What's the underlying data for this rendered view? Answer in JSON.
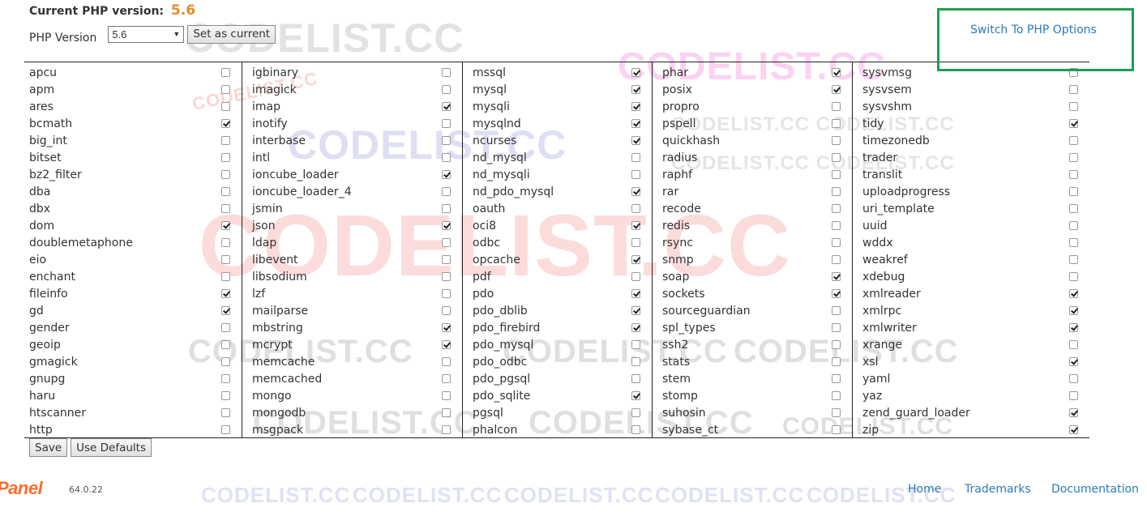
{
  "header": {
    "current_label": "Current PHP version:",
    "current_value": "5.6",
    "version_label": "PHP Version",
    "version_selected": "5.6",
    "set_current_label": "Set as current",
    "switch_link": "Switch To PHP Options"
  },
  "columns": [
    [
      {
        "name": "apcu",
        "checked": false
      },
      {
        "name": "apm",
        "checked": false
      },
      {
        "name": "ares",
        "checked": false
      },
      {
        "name": "bcmath",
        "checked": true
      },
      {
        "name": "big_int",
        "checked": false
      },
      {
        "name": "bitset",
        "checked": false
      },
      {
        "name": "bz2_filter",
        "checked": false
      },
      {
        "name": "dba",
        "checked": false
      },
      {
        "name": "dbx",
        "checked": false
      },
      {
        "name": "dom",
        "checked": true
      },
      {
        "name": "doublemetaphone",
        "checked": false
      },
      {
        "name": "eio",
        "checked": false
      },
      {
        "name": "enchant",
        "checked": false
      },
      {
        "name": "fileinfo",
        "checked": true
      },
      {
        "name": "gd",
        "checked": true
      },
      {
        "name": "gender",
        "checked": false
      },
      {
        "name": "geoip",
        "checked": false
      },
      {
        "name": "gmagick",
        "checked": false
      },
      {
        "name": "gnupg",
        "checked": false
      },
      {
        "name": "haru",
        "checked": false
      },
      {
        "name": "htscanner",
        "checked": false
      },
      {
        "name": "http",
        "checked": false
      }
    ],
    [
      {
        "name": "igbinary",
        "checked": false
      },
      {
        "name": "imagick",
        "checked": false
      },
      {
        "name": "imap",
        "checked": true
      },
      {
        "name": "inotify",
        "checked": false
      },
      {
        "name": "interbase",
        "checked": false
      },
      {
        "name": "intl",
        "checked": false
      },
      {
        "name": "ioncube_loader",
        "checked": true
      },
      {
        "name": "ioncube_loader_4",
        "checked": false
      },
      {
        "name": "jsmin",
        "checked": false
      },
      {
        "name": "json",
        "checked": true
      },
      {
        "name": "ldap",
        "checked": false
      },
      {
        "name": "libevent",
        "checked": false
      },
      {
        "name": "libsodium",
        "checked": false
      },
      {
        "name": "lzf",
        "checked": false
      },
      {
        "name": "mailparse",
        "checked": false
      },
      {
        "name": "mbstring",
        "checked": true
      },
      {
        "name": "mcrypt",
        "checked": true
      },
      {
        "name": "memcache",
        "checked": false
      },
      {
        "name": "memcached",
        "checked": false
      },
      {
        "name": "mongo",
        "checked": false
      },
      {
        "name": "mongodb",
        "checked": false
      },
      {
        "name": "msgpack",
        "checked": false
      }
    ],
    [
      {
        "name": "mssql",
        "checked": true
      },
      {
        "name": "mysql",
        "checked": true
      },
      {
        "name": "mysqli",
        "checked": true
      },
      {
        "name": "mysqlnd",
        "checked": true
      },
      {
        "name": "ncurses",
        "checked": true
      },
      {
        "name": "nd_mysql",
        "checked": false
      },
      {
        "name": "nd_mysqli",
        "checked": false
      },
      {
        "name": "nd_pdo_mysql",
        "checked": true
      },
      {
        "name": "oauth",
        "checked": false
      },
      {
        "name": "oci8",
        "checked": true
      },
      {
        "name": "odbc",
        "checked": false
      },
      {
        "name": "opcache",
        "checked": true
      },
      {
        "name": "pdf",
        "checked": false
      },
      {
        "name": "pdo",
        "checked": true
      },
      {
        "name": "pdo_dblib",
        "checked": true
      },
      {
        "name": "pdo_firebird",
        "checked": true
      },
      {
        "name": "pdo_mysql",
        "checked": false
      },
      {
        "name": "pdo_odbc",
        "checked": false
      },
      {
        "name": "pdo_pgsql",
        "checked": false
      },
      {
        "name": "pdo_sqlite",
        "checked": true
      },
      {
        "name": "pgsql",
        "checked": false
      },
      {
        "name": "phalcon",
        "checked": false
      }
    ],
    [
      {
        "name": "phar",
        "checked": true
      },
      {
        "name": "posix",
        "checked": true
      },
      {
        "name": "propro",
        "checked": false
      },
      {
        "name": "pspell",
        "checked": false
      },
      {
        "name": "quickhash",
        "checked": false
      },
      {
        "name": "radius",
        "checked": false
      },
      {
        "name": "raphf",
        "checked": false
      },
      {
        "name": "rar",
        "checked": false
      },
      {
        "name": "recode",
        "checked": false
      },
      {
        "name": "redis",
        "checked": false
      },
      {
        "name": "rsync",
        "checked": false
      },
      {
        "name": "snmp",
        "checked": false
      },
      {
        "name": "soap",
        "checked": true
      },
      {
        "name": "sockets",
        "checked": true
      },
      {
        "name": "sourceguardian",
        "checked": false
      },
      {
        "name": "spl_types",
        "checked": false
      },
      {
        "name": "ssh2",
        "checked": false
      },
      {
        "name": "stats",
        "checked": false
      },
      {
        "name": "stem",
        "checked": false
      },
      {
        "name": "stomp",
        "checked": false
      },
      {
        "name": "suhosin",
        "checked": false
      },
      {
        "name": "sybase_ct",
        "checked": false
      }
    ],
    [
      {
        "name": "sysvmsg",
        "checked": false
      },
      {
        "name": "sysvsem",
        "checked": false
      },
      {
        "name": "sysvshm",
        "checked": false
      },
      {
        "name": "tidy",
        "checked": true
      },
      {
        "name": "timezonedb",
        "checked": false
      },
      {
        "name": "trader",
        "checked": false
      },
      {
        "name": "translit",
        "checked": false
      },
      {
        "name": "uploadprogress",
        "checked": false
      },
      {
        "name": "uri_template",
        "checked": false
      },
      {
        "name": "uuid",
        "checked": false
      },
      {
        "name": "wddx",
        "checked": false
      },
      {
        "name": "weakref",
        "checked": false
      },
      {
        "name": "xdebug",
        "checked": false
      },
      {
        "name": "xmlreader",
        "checked": true
      },
      {
        "name": "xmlrpc",
        "checked": true
      },
      {
        "name": "xmlwriter",
        "checked": true
      },
      {
        "name": "xrange",
        "checked": false
      },
      {
        "name": "xsl",
        "checked": true
      },
      {
        "name": "yaml",
        "checked": false
      },
      {
        "name": "yaz",
        "checked": false
      },
      {
        "name": "zend_guard_loader",
        "checked": true
      },
      {
        "name": "zip",
        "checked": true
      }
    ]
  ],
  "actions": {
    "save_label": "Save",
    "defaults_label": "Use Defaults"
  },
  "footer": {
    "logo": "Panel",
    "version": "64.0.22",
    "links": [
      "Home",
      "Trademarks",
      "Documentation"
    ]
  },
  "watermark": {
    "text": "CODELIST.CC",
    "line": "CODELIST.CC CODELIST.CC"
  },
  "colors": {
    "version_accent": "#e8892b",
    "link": "#2a7bb8",
    "highlight_box": "#1e9e50",
    "logo": "#ff6c2c"
  }
}
